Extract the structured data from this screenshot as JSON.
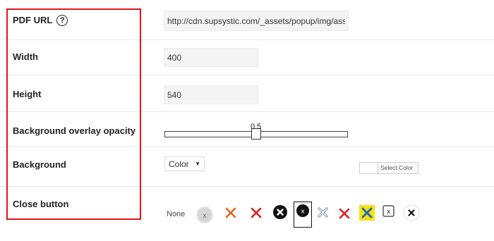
{
  "settings": {
    "pdf_url": {
      "label": "PDF URL",
      "value": "http://cdn.supsystic.com/_assets/popup/img/asse"
    },
    "width": {
      "label": "Width",
      "value": "400"
    },
    "height": {
      "label": "Height",
      "value": "540"
    },
    "overlay_opacity": {
      "label": "Background overlay opacity",
      "value": "0.5",
      "level": 0.5
    },
    "background": {
      "label": "Background",
      "select_value": "Color",
      "select_color_label": "Select Color"
    },
    "close_button": {
      "label": "Close button",
      "none_label": "None",
      "options": [
        {
          "icon": "grey-circle-x-icon"
        },
        {
          "icon": "orange-x-icon"
        },
        {
          "icon": "red-x-icon"
        },
        {
          "icon": "black-circle-white-x-icon"
        },
        {
          "icon": "black-circle-x-selected-icon"
        },
        {
          "icon": "light-blue-x-icon"
        },
        {
          "icon": "red-x-icon"
        },
        {
          "icon": "yellow-square-blue-x-icon"
        },
        {
          "icon": "boxed-x-icon"
        },
        {
          "icon": "white-circle-black-x-icon"
        }
      ]
    }
  },
  "icons": {
    "help": "?",
    "select_caret": "▼",
    "grey_circle_x": "x",
    "black_circle_x": "x",
    "boxed_x": "x"
  },
  "colors": {
    "highlight_border": "#e0141c",
    "orange": "#e5651b",
    "red": "#e31b1b",
    "yellow": "#f7e012",
    "blue": "#1e6ab3"
  }
}
